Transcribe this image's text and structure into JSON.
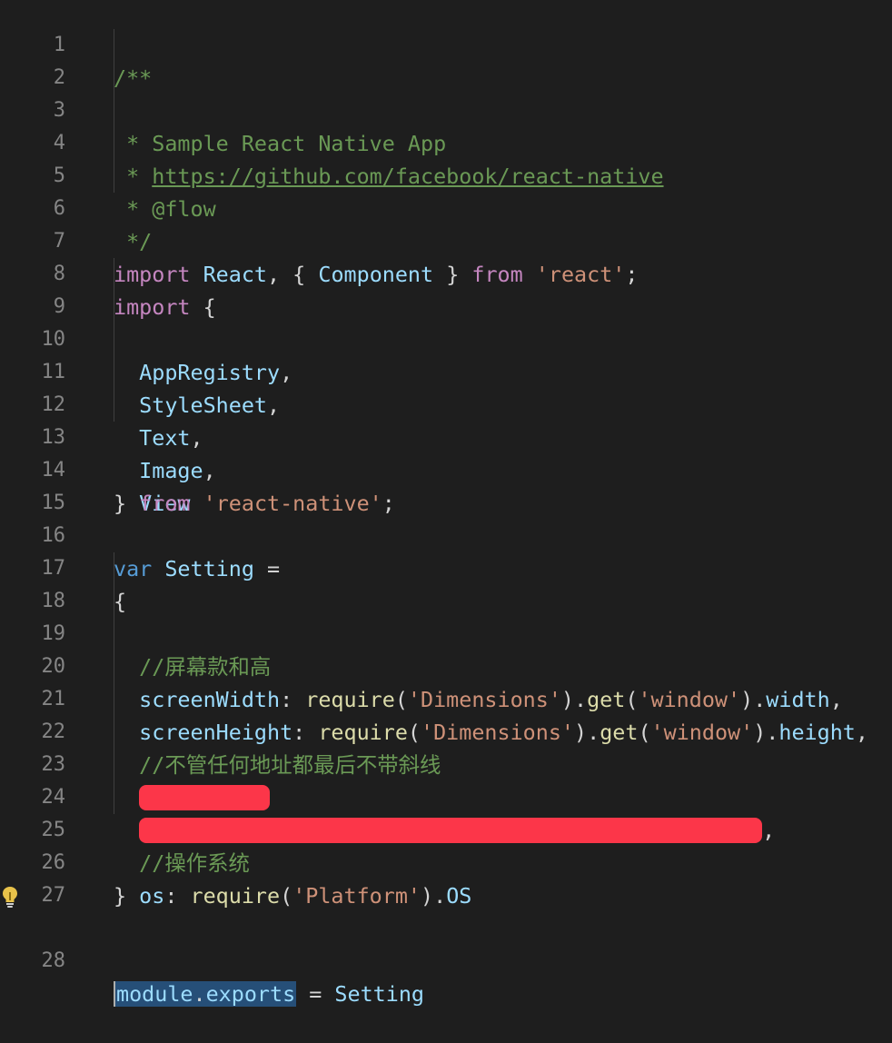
{
  "editor": {
    "line_numbers": [
      "1",
      "2",
      "3",
      "4",
      "5",
      "6",
      "7",
      "8",
      "9",
      "10",
      "11",
      "12",
      "13",
      "14",
      "15",
      "16",
      "17",
      "18",
      "19",
      "20",
      "21",
      "22",
      "23",
      "24",
      "25",
      "26",
      "27",
      "28"
    ],
    "line2": "* Sample React Native App",
    "line3_star": "* ",
    "line3_link": "https://github.com/facebook/react-native",
    "line4": "* @flow",
    "line5": "*/",
    "comment_open": "/**",
    "kw_import": "import",
    "kw_from": "from",
    "kw_var": "var",
    "react": "React",
    "component": "Component",
    "str_react": "'react'",
    "appregistry": "AppRegistry",
    "stylesheet": "StyleSheet",
    "text": "Text",
    "image": "Image",
    "view": "View",
    "str_react_native": "'react-native'",
    "setting": "Setting",
    "comment_screen": "//屏幕款和高",
    "screenwidth": "screenWidth",
    "screenheight": "screenHeight",
    "fn_require": "require",
    "str_dimensions": "'Dimensions'",
    "fn_get": "get",
    "str_window": "'window'",
    "width": "width",
    "height": "height",
    "comment_url": "//不管任何地址都最后不带斜线",
    "comment_os": "//操作系统",
    "os": "os",
    "str_platform": "'Platform'",
    "os_const": "OS",
    "module": "module",
    "exports": "exports"
  },
  "colors": {
    "background": "#1e1e1e",
    "comment": "#6a9955",
    "keyword_import": "#c586c0",
    "keyword_var": "#569cd6",
    "identifier": "#9cdcfe",
    "string": "#ce9178",
    "function": "#dcdcaa",
    "redaction": "#fc3649"
  },
  "icons": {
    "gutter": "lightbulb-icon"
  }
}
